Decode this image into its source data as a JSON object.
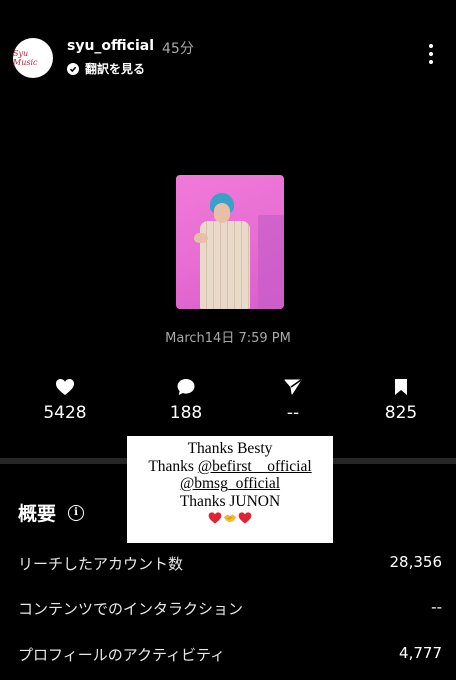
{
  "header": {
    "avatar_text": "Syu Music",
    "username": "syu_official",
    "time_ago": "45分",
    "translate_label": "翻訳を見る"
  },
  "story": {
    "date": "March14日 7:59 PM"
  },
  "stats": [
    {
      "icon": "heart-icon",
      "value": "5428"
    },
    {
      "icon": "comment-icon",
      "value": "188"
    },
    {
      "icon": "send-icon",
      "value": "--"
    },
    {
      "icon": "bookmark-icon",
      "value": "825"
    }
  ],
  "overview": {
    "title": "概要",
    "info_icon": "i"
  },
  "metrics": [
    {
      "label": "リーチしたアカウント数",
      "value": "28,356"
    },
    {
      "label": "コンテンツでのインタラクション",
      "value": "--"
    },
    {
      "label": "プロフィールのアクティビティ",
      "value": "4,777"
    }
  ],
  "sticker": {
    "line1": "Thanks Besty",
    "line2_prefix": "Thanks ",
    "line2_handle": "@befirst__official",
    "line3_handle": "@bmsg_official",
    "line4": "Thanks JUNON",
    "emoji": [
      "red-heart",
      "handshake",
      "red-heart"
    ]
  },
  "colors": {
    "background": "#000000",
    "secondary_text": "#a8a8a8",
    "divider": "#262626",
    "story_pink": "#e76dd3"
  }
}
